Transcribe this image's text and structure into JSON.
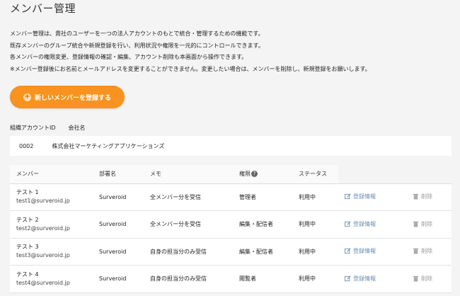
{
  "page": {
    "title": "メンバー管理",
    "description": [
      "メンバー管理は、貴社のユーザーを一つの法人アカウントのもとで統合・管理するための機能です。",
      "既存メンバーのグループ統合や新規登録を行い、利用状況や権限を一元的にコントロールできます。",
      "各メンバーの権限変更、登録情報の確認・編集、アカウント削除も本画面から操作できます。",
      "※メンバー登録後にお名前とメールアドレスを変更することができません。変更したい場合は、メンバーを削除し、新規登録をお願いします。"
    ],
    "add_button_label": "新しいメンバーを登録する"
  },
  "organization": {
    "header_id": "組織アカウントID",
    "header_company": "会社名",
    "id": "0002",
    "company": "株式会社マーケティングアプリケーションズ"
  },
  "table": {
    "columns": [
      "メンバー",
      "部署名",
      "メモ",
      "権限",
      "ステータス"
    ],
    "help_icon": "?",
    "edit_label": "登録情報",
    "delete_label": "削除",
    "rows": [
      {
        "name": "テスト 1",
        "email": "test1@surveroid.jp",
        "department": "Surveroid",
        "memo": "全メンバー分を受信",
        "role": "管理者",
        "status": "利用中"
      },
      {
        "name": "テスト 2",
        "email": "test2@surveroid.jp",
        "department": "Surveroid",
        "memo": "全メンバー分を受信",
        "role": "編集・配信者",
        "status": "利用中"
      },
      {
        "name": "テスト 3",
        "email": "test3@surveroid.jp",
        "department": "Surveroid",
        "memo": "自身の担当分のみ受信",
        "role": "編集・配信者",
        "status": "利用中"
      },
      {
        "name": "テスト 4",
        "email": "test4@surveroid.jp",
        "department": "Surveroid",
        "memo": "自身の担当分のみ受信",
        "role": "閲覧者",
        "status": "利用中"
      }
    ]
  },
  "colors": {
    "accent": "#f7931e",
    "link": "#6a8fb3"
  }
}
